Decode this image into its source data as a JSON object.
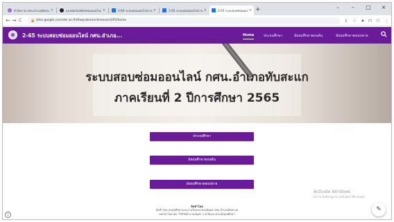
{
  "browser": {
    "tabs": [
      {
        "label": "สำนักงาน กศน.อำเภอทับสะแก - ",
        "favicon_color": "#9c6ad9",
        "close": "×"
      },
      {
        "label": "แบบฟอร์มสมัครสอบออนไลน์ - ",
        "favicon_color": "#202124",
        "close": "×"
      },
      {
        "label": "2-64 ระบบสอบออนไลน์ กศน.",
        "favicon_color": "#1a73e8",
        "close": "×"
      },
      {
        "label": "1-65 ระบบสอบออนไลน์ กศน.",
        "favicon_color": "#1a73e8",
        "close": "×"
      },
      {
        "label": "2-65 ระบบสอบซ่อมออนไลน์ กศน.",
        "favicon_color": "#1a73e8",
        "close": "×"
      }
    ],
    "new_tab": "+",
    "window_buttons": [
      "⌄",
      "–",
      "□",
      "×"
    ],
    "nav_buttons": [
      "←",
      "→",
      "C",
      "⌂"
    ],
    "url": "sites.google.com/dei.ac.th/thepsakaeonlineexam265/home",
    "toolbar_icons": [
      "⇪",
      "☆",
      "★",
      "⊓",
      "⚇",
      "⋮"
    ]
  },
  "site": {
    "name": "2-65 ระบบสอบซ่อมออนไลน์ กศน.อำเภอ...",
    "nav": [
      "Home",
      "ประถมศึกษา",
      "มัธยมศึกษาตอนต้น",
      "มัธยมศึกษาตอนปลาย"
    ],
    "search_icon": "search-icon"
  },
  "hero": {
    "line1": "ระบบสอบซ่อมออนไลน์ กศน.อำเภอทับสะแก",
    "line2": "ภาคเรียนที่ 2 ปีการศึกษา 2565"
  },
  "buttons": [
    "ประถมศึกษา",
    "มัธยมศึกษาตอนต้น",
    "มัธยมศึกษาตอนปลาย"
  ],
  "footer": {
    "line1": "จัดทำโดย",
    "line2": "จัดทำโดย สนนักศึกษาและงานวัดและประเมินผล กศน.อำเภอทับสะแก",
    "line3": "ออกนำโดย ผศ. วิรัชวิทย์ นามสมุทร งานวัดและประเมินผลศึกษา"
  },
  "watermark": {
    "title": "Activate Windows",
    "subtitle": "Go to Settings to activate Windows."
  },
  "colors": {
    "brand": "#6a1b9a"
  }
}
